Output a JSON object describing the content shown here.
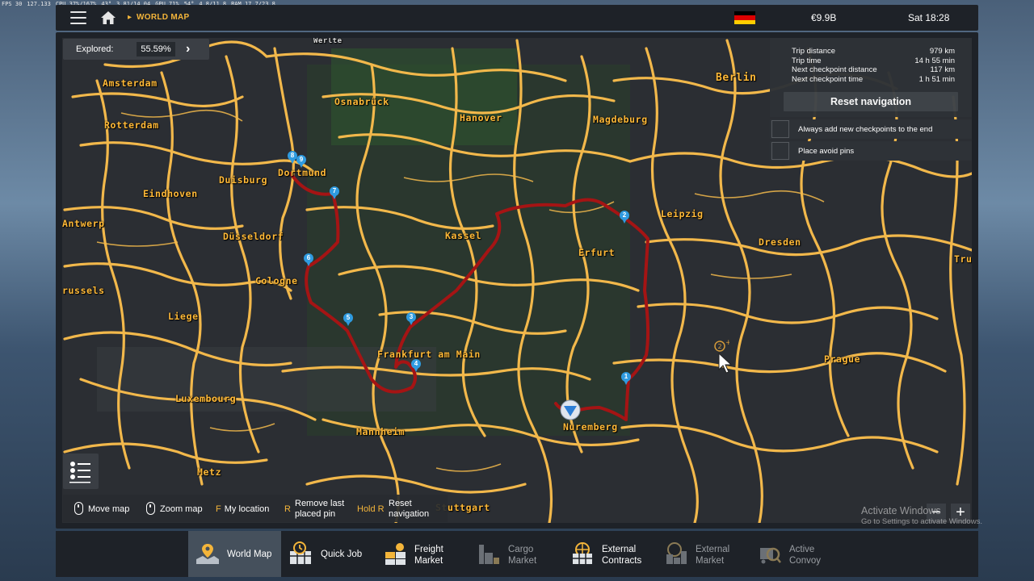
{
  "debug": {
    "fps": "FPS 30",
    "fps_extra": "127.133",
    "cpu": "CPU 37%/167%",
    "cpu_temp": "43°",
    "cpu_clock": "3.81/14.04",
    "gpu": "GPU 71%",
    "gpu_temp": "54°",
    "gpu_mem": "4.8/11.8",
    "ram": "RAM 17.7/23.8"
  },
  "header": {
    "breadcrumb": "WORLD MAP",
    "money": "€9.9B",
    "clock": "Sat 18:28",
    "flag_colors": [
      "#000000",
      "#dd0000",
      "#ffce00"
    ]
  },
  "explored": {
    "label": "Explored:",
    "value": "55.59%"
  },
  "trip": {
    "rows": [
      {
        "label": "Trip distance",
        "value": "979 km"
      },
      {
        "label": "Trip time",
        "value": "14 h 55 min"
      },
      {
        "label": "Next checkpoint distance",
        "value": "117 km"
      },
      {
        "label": "Next checkpoint time",
        "value": "1 h 51 min"
      }
    ],
    "reset_button": "Reset navigation",
    "options": [
      {
        "label": "Always add new checkpoints to the end"
      },
      {
        "label": "Place avoid pins"
      }
    ]
  },
  "cities": [
    {
      "name": "Werlte"
    },
    {
      "name": "Amsterdam"
    },
    {
      "name": "Osnabrück"
    },
    {
      "name": "Berlin"
    },
    {
      "name": "Hanover"
    },
    {
      "name": "Magdeburg"
    },
    {
      "name": "Rotterdam"
    },
    {
      "name": "Duisburg"
    },
    {
      "name": "Dortmund"
    },
    {
      "name": "Eindhoven"
    },
    {
      "name": "Antwerp"
    },
    {
      "name": "Leipzig"
    },
    {
      "name": "Düsseldorf"
    },
    {
      "name": "Kassel"
    },
    {
      "name": "Dresden"
    },
    {
      "name": "Erfurt"
    },
    {
      "name": "Tru"
    },
    {
      "name": "Cologne"
    },
    {
      "name": "russels"
    },
    {
      "name": "Liege"
    },
    {
      "name": "Frankfurt am Main"
    },
    {
      "name": "Prague"
    },
    {
      "name": "Luxembourg"
    },
    {
      "name": "Nuremberg"
    },
    {
      "name": "Mannheim"
    },
    {
      "name": "Metz"
    },
    {
      "name": "Stuttgart"
    }
  ],
  "pins": [
    "1",
    "2",
    "3",
    "4",
    "5",
    "6",
    "7",
    "8",
    "9"
  ],
  "hints": {
    "move": "Move map",
    "zoom": "Zoom map",
    "location_key": "F",
    "location": "My location",
    "remove_key": "R",
    "remove": "Remove last placed pin",
    "reset_key": "Hold R",
    "reset": "Reset navigation"
  },
  "watermark": {
    "line1": "Activate Windows",
    "line2": "Go to Settings to activate Windows."
  },
  "tabs": [
    {
      "label": "World Map",
      "active": true
    },
    {
      "label": "Quick Job"
    },
    {
      "label": "Freight Market"
    },
    {
      "label": "Cargo Market",
      "disabled": true
    },
    {
      "label": "External Contracts"
    },
    {
      "label": "External Market",
      "disabled": true
    },
    {
      "label": "Active Convoy",
      "disabled": true
    }
  ],
  "colors": {
    "road": "#f2b84b",
    "route": "#a51414",
    "city_label": "#ffb937",
    "accent": "#f4b53a",
    "pin": "#2f9be0"
  }
}
